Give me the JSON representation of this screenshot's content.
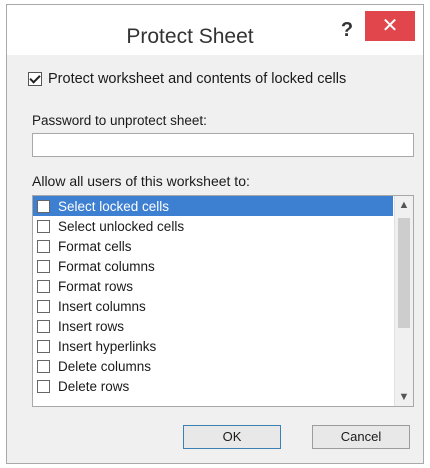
{
  "dialog": {
    "title": "Protect Sheet",
    "help_label": "?",
    "close_label": "✕"
  },
  "protect": {
    "checked": true,
    "label": "Protect worksheet and contents of locked cells"
  },
  "password": {
    "label": "Password to unprotect sheet:",
    "value": ""
  },
  "allow": {
    "label": "Allow all users of this worksheet to:",
    "items": [
      {
        "label": "Select locked cells",
        "checked": false,
        "selected": true
      },
      {
        "label": "Select unlocked cells",
        "checked": false,
        "selected": false
      },
      {
        "label": "Format cells",
        "checked": false,
        "selected": false
      },
      {
        "label": "Format columns",
        "checked": false,
        "selected": false
      },
      {
        "label": "Format rows",
        "checked": false,
        "selected": false
      },
      {
        "label": "Insert columns",
        "checked": false,
        "selected": false
      },
      {
        "label": "Insert rows",
        "checked": false,
        "selected": false
      },
      {
        "label": "Insert hyperlinks",
        "checked": false,
        "selected": false
      },
      {
        "label": "Delete columns",
        "checked": false,
        "selected": false
      },
      {
        "label": "Delete rows",
        "checked": false,
        "selected": false
      }
    ]
  },
  "buttons": {
    "ok": "OK",
    "cancel": "Cancel"
  },
  "icons": {
    "scroll_up": "chevron-up-icon",
    "scroll_down": "chevron-down-icon"
  }
}
